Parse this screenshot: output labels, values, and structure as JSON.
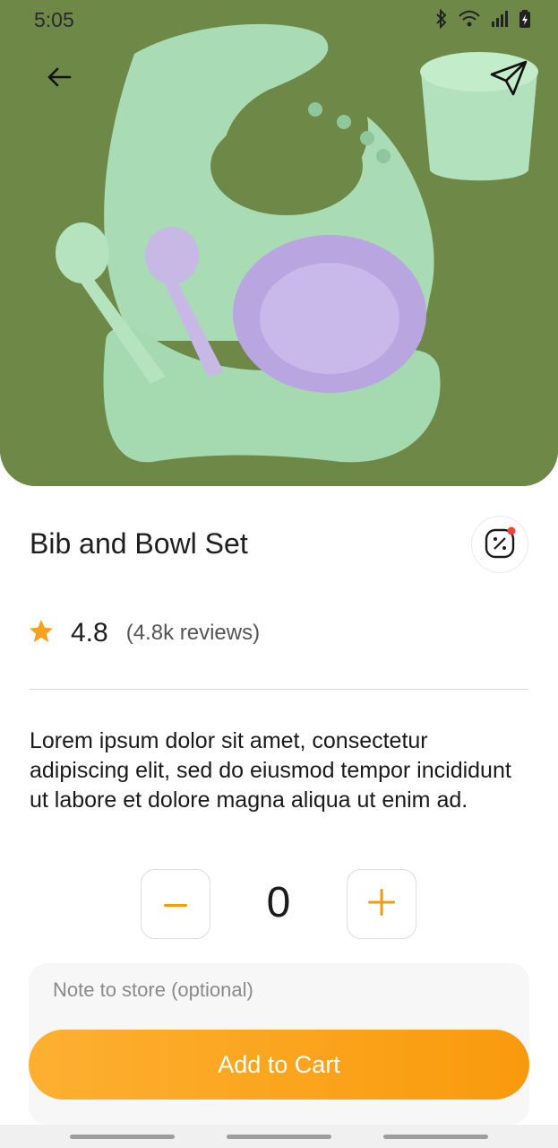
{
  "status_bar": {
    "time": "5:05"
  },
  "product": {
    "title": "Bib and Bowl Set",
    "rating": "4.8",
    "reviews": "(4.8k reviews)",
    "description": "Lorem ipsum dolor sit amet, consectetur adipiscing elit, sed do eiusmod tempor incididunt ut labore et dolore magna aliqua ut enim ad."
  },
  "quantity": {
    "minus": "−",
    "value": "0",
    "plus": "+"
  },
  "note": {
    "placeholder": "Note to store (optional)",
    "value": ""
  },
  "cart": {
    "label": "Add to Cart"
  },
  "colors": {
    "accent": "#f99a0c",
    "star": "#f7a21f",
    "badge_dot": "#f44336"
  },
  "icons": [
    "arrow-left-icon",
    "send-icon",
    "discount-icon",
    "star-icon",
    "minus-icon",
    "plus-icon",
    "bluetooth-icon",
    "wifi-icon",
    "signal-icon",
    "battery-icon"
  ]
}
